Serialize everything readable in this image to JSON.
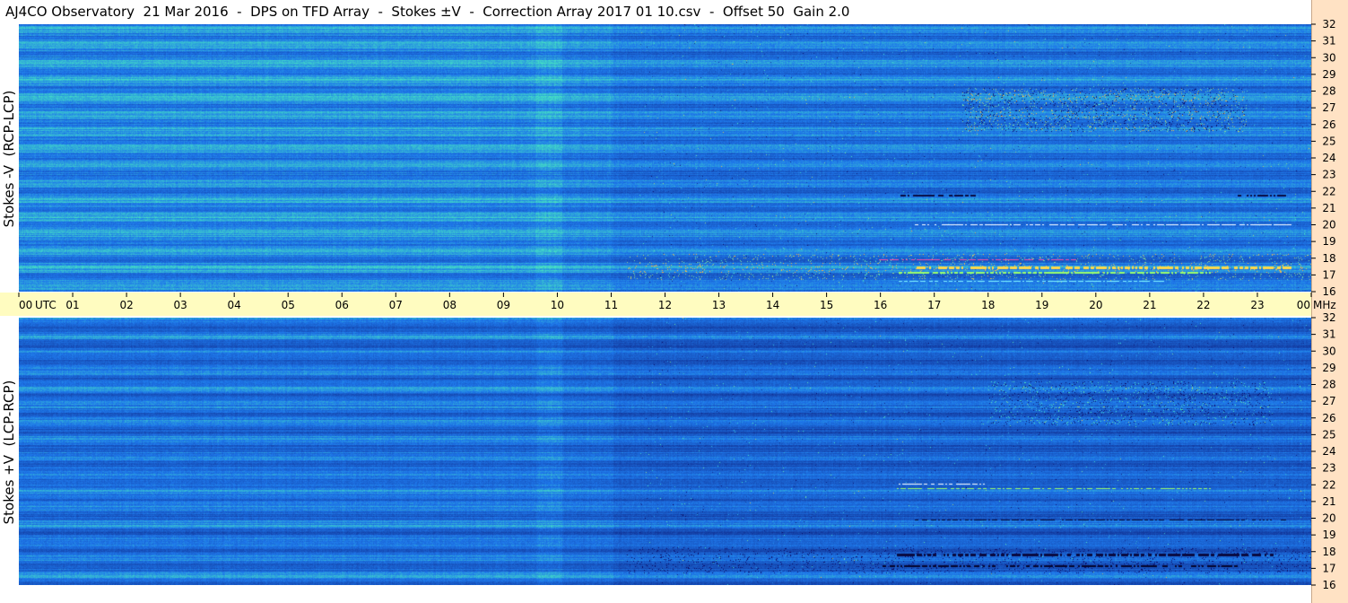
{
  "title": "AJ4CO Observatory  21 Mar 2016  -  DPS on TFD Array  -  Stokes ±V  -  Correction Array 2017 01 10.csv  -  Offset 50  Gain 2.0",
  "chart_data": [
    {
      "type": "heatmap",
      "ylabel": "Stokes -V  (RCP-LCP)",
      "y_ticks": [
        16,
        17,
        18,
        19,
        20,
        21,
        22,
        23,
        24,
        25,
        26,
        27,
        28,
        29,
        30,
        31,
        32
      ],
      "ylim": [
        16,
        32
      ],
      "x_ticks": [
        "00",
        "01",
        "02",
        "03",
        "04",
        "05",
        "06",
        "07",
        "08",
        "09",
        "10",
        "11",
        "12",
        "13",
        "14",
        "15",
        "16",
        "17",
        "18",
        "19",
        "20",
        "21",
        "22",
        "23",
        "00"
      ],
      "x_unit": "UTC",
      "y_unit": "MHz",
      "colors": {
        "low": "#0a0a60",
        "mid": "#1e7ee8",
        "high": "#ffe040",
        "peak": "#ff40a0"
      }
    },
    {
      "type": "heatmap",
      "ylabel": "Stokes +V  (LCP-RCP)",
      "y_ticks": [
        16,
        17,
        18,
        19,
        20,
        21,
        22,
        23,
        24,
        25,
        26,
        27,
        28,
        29,
        30,
        31,
        32
      ],
      "ylim": [
        16,
        32
      ],
      "x_ticks": [
        "00",
        "01",
        "02",
        "03",
        "04",
        "05",
        "06",
        "07",
        "08",
        "09",
        "10",
        "11",
        "12",
        "13",
        "14",
        "15",
        "16",
        "17",
        "18",
        "19",
        "20",
        "21",
        "22",
        "23",
        "00"
      ],
      "x_unit": "UTC",
      "y_unit": "MHz",
      "colors": {
        "low": "#0a0a60",
        "mid": "#1c6ae0",
        "high": "#ffe040",
        "peak": "#ff40a0"
      }
    }
  ]
}
